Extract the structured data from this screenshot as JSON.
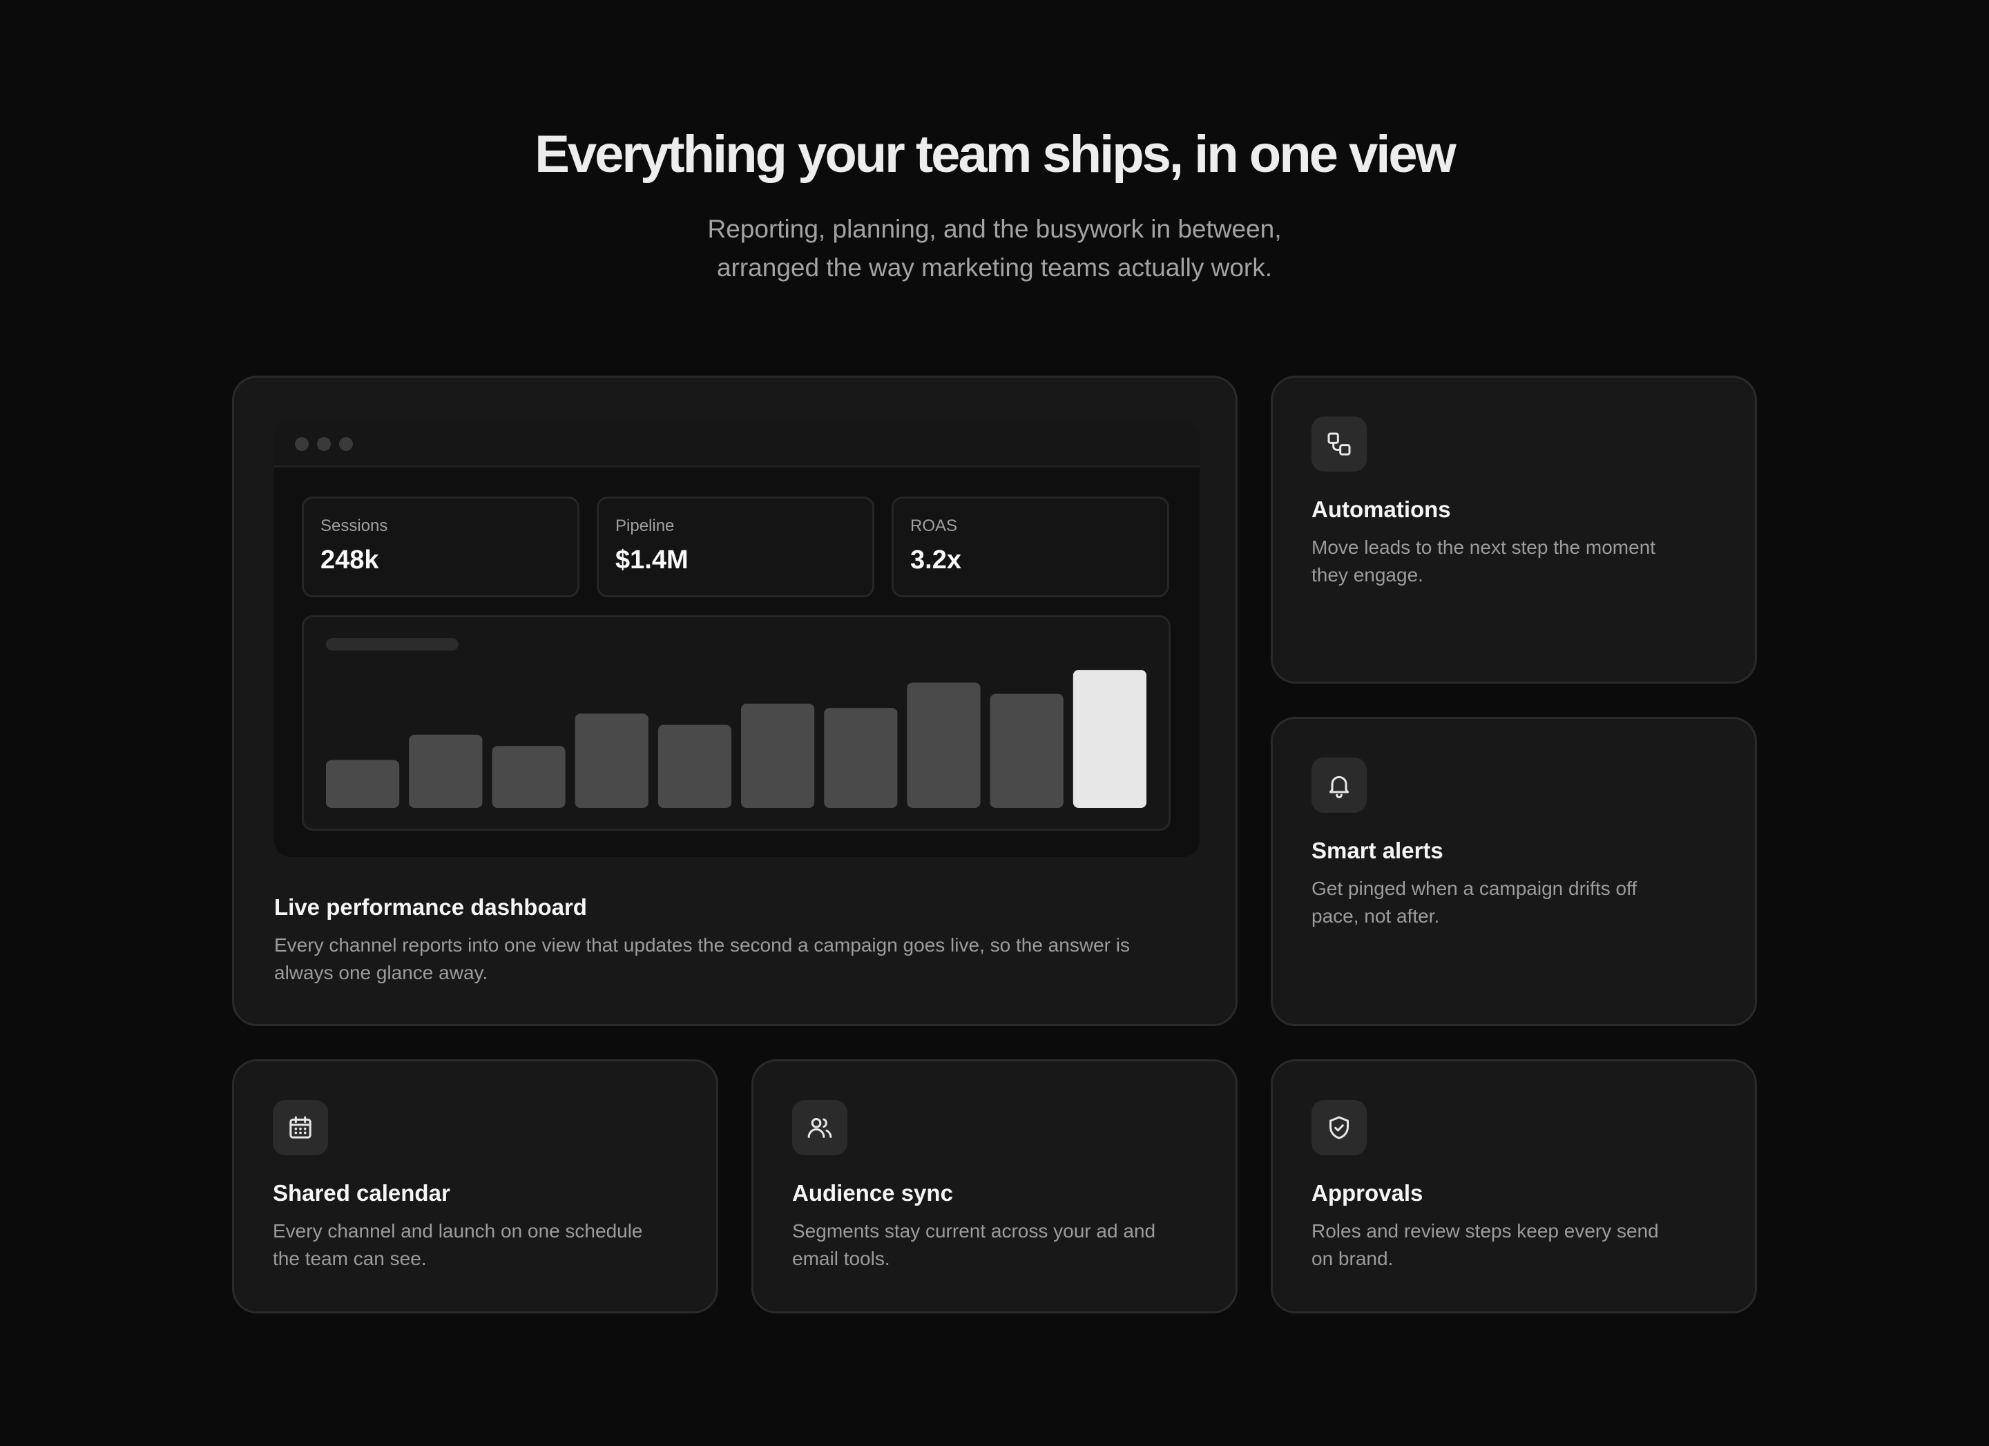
{
  "hero": {
    "title": "Everything your team ships, in one view",
    "subtitle_line1": "Reporting, planning, and the busywork in between,",
    "subtitle_line2": "arranged the way marketing teams actually work."
  },
  "dashboard_card": {
    "title": "Live performance dashboard",
    "desc_line1": "Every channel reports into one view that updates the second a campaign goes live, so the answer is",
    "desc_line2": "always one glance away.",
    "stats": [
      {
        "label": "Sessions",
        "value": "248k"
      },
      {
        "label": "Pipeline",
        "value": "$1.4M"
      },
      {
        "label": "ROAS",
        "value": "3.2x"
      }
    ],
    "chart_data": {
      "type": "bar",
      "values": [
        34,
        52,
        44,
        67,
        59,
        74,
        71,
        89,
        81,
        98
      ],
      "highlight_index": 9,
      "ylim": [
        0,
        100
      ],
      "bar_color": "#4a4a4a",
      "highlight_color": "#e6e6e6"
    }
  },
  "automations": {
    "icon": "workflow-icon",
    "title": "Automations",
    "desc_line1": "Move leads to the next step the moment",
    "desc_line2": "they engage."
  },
  "smart_alerts": {
    "icon": "bell-icon",
    "title": "Smart alerts",
    "desc_line1": "Get pinged when a campaign drifts off",
    "desc_line2": "pace, not after."
  },
  "shared_calendar": {
    "icon": "calendar-icon",
    "title": "Shared calendar",
    "desc_line1": "Every channel and launch on one schedule",
    "desc_line2": "the team can see."
  },
  "audience_sync": {
    "icon": "users-icon",
    "title": "Audience sync",
    "desc_line1": "Segments stay current across your ad and",
    "desc_line2": "email tools."
  },
  "approvals": {
    "icon": "shield-check-icon",
    "title": "Approvals",
    "desc_line1": "Roles and review steps keep every send",
    "desc_line2": "on brand."
  }
}
